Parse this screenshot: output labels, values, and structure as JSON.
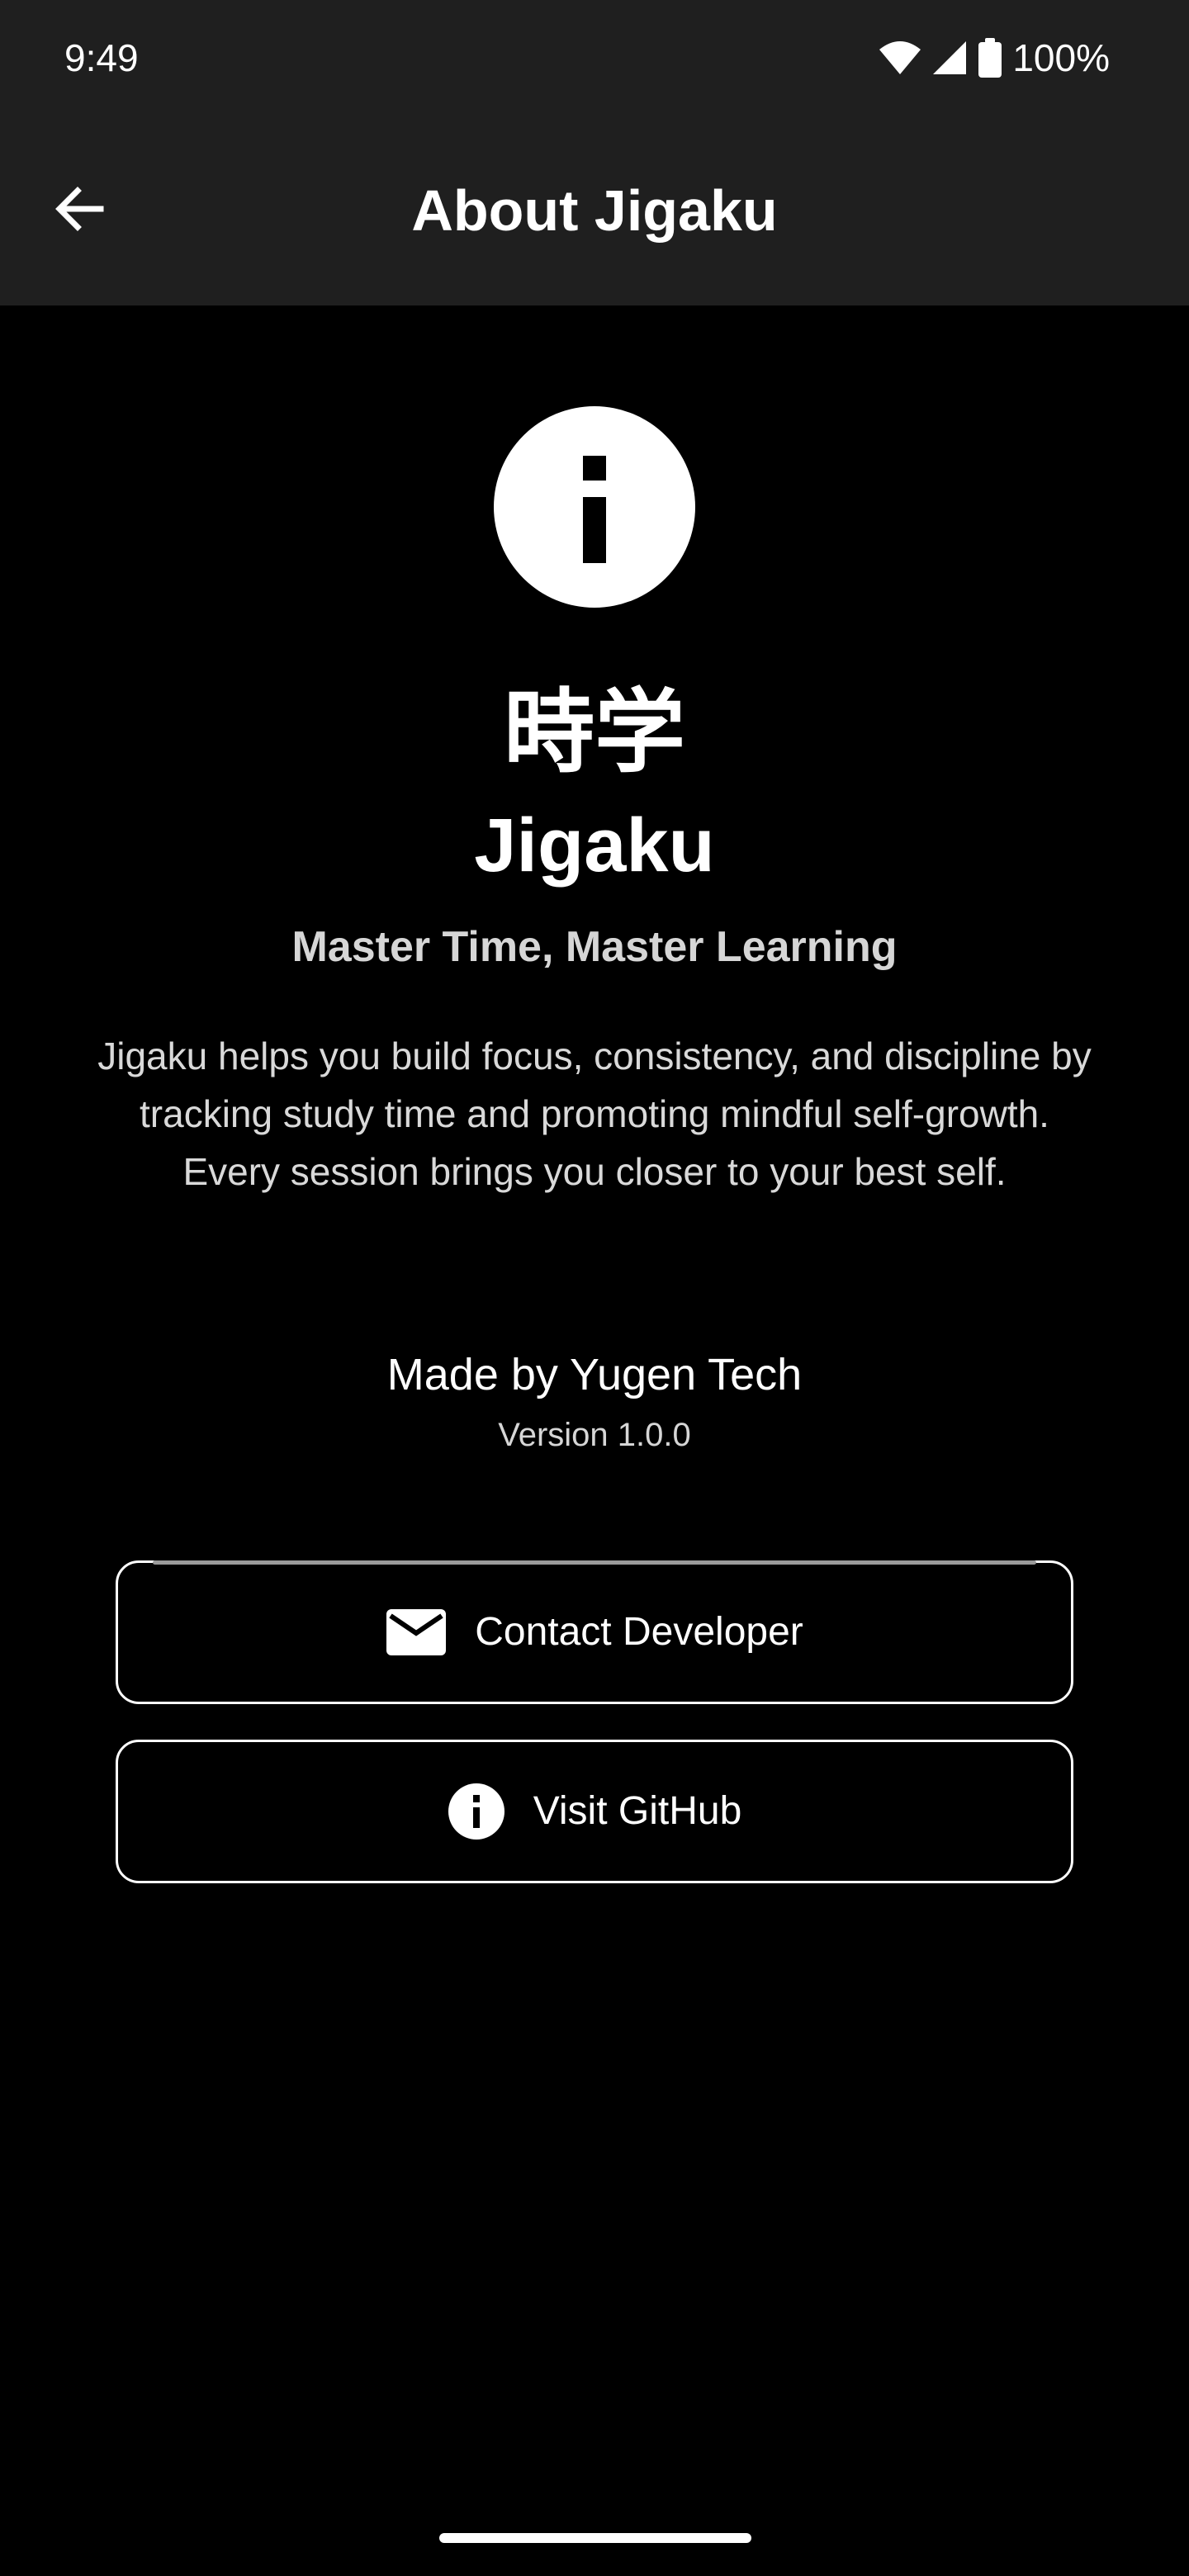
{
  "status_bar": {
    "time": "9:49",
    "battery_percent": "100%",
    "icons": [
      "wifi-icon",
      "signal-icon",
      "battery-icon"
    ]
  },
  "app_bar": {
    "title": "About Jigaku",
    "back_icon": "arrow-back-icon"
  },
  "about": {
    "logo_icon": "info-icon",
    "kanji": "時学",
    "app_name": "Jigaku",
    "tagline": "Master Time, Master Learning",
    "description": "Jigaku helps you build focus, consistency, and discipline by tracking study time and promoting mindful self-growth. Every session brings you closer to your best self.",
    "made_by": "Made by Yugen Tech",
    "version": "Version 1.0.0"
  },
  "actions": {
    "contact": {
      "label": "Contact Developer",
      "icon": "mail-icon"
    },
    "github": {
      "label": "Visit GitHub",
      "icon": "info-icon"
    }
  },
  "colors": {
    "background": "#000000",
    "bar_background": "#1f1f1f",
    "foreground": "#ffffff",
    "secondary_text": "#d6d6d6"
  }
}
